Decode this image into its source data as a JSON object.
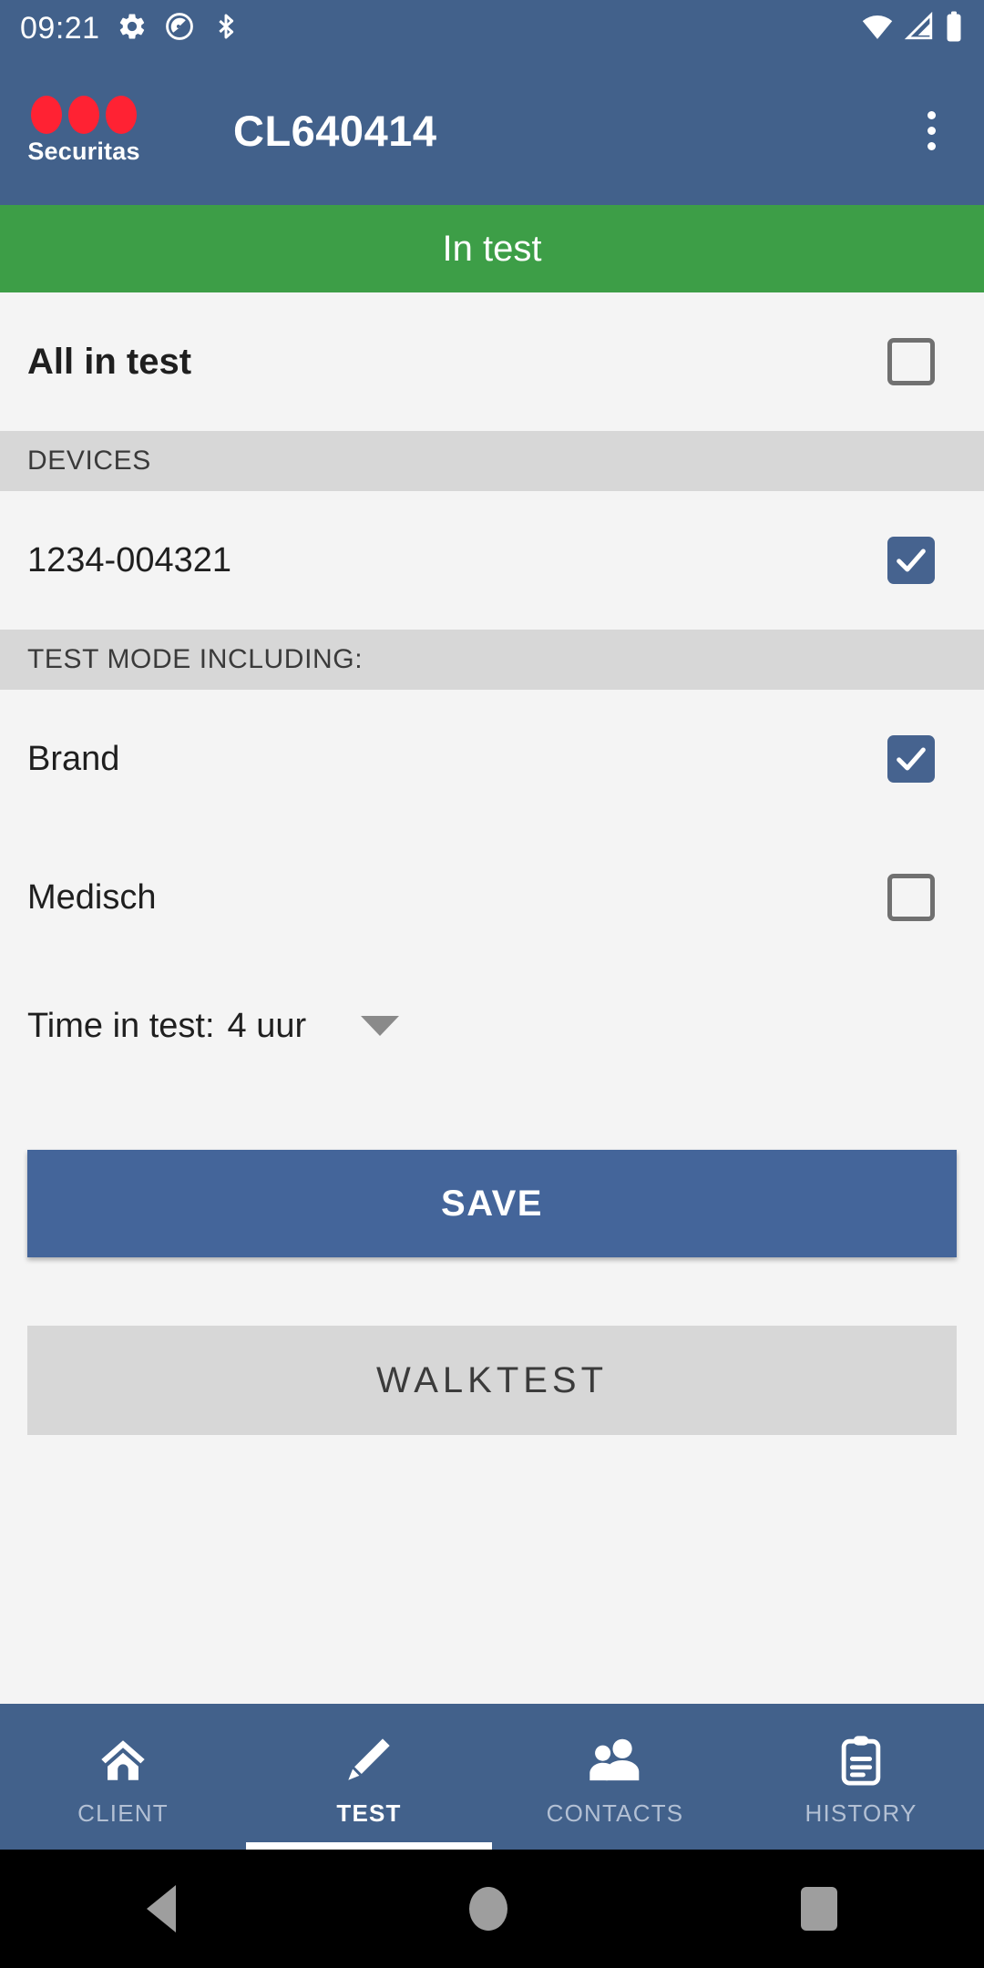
{
  "status_bar": {
    "time": "09:21",
    "left_icons": [
      "gear-icon",
      "quick-settings-icon",
      "bluetooth-icon"
    ],
    "right_icons": [
      "wifi-icon",
      "cellular-signal-icon",
      "battery-icon"
    ]
  },
  "app_bar": {
    "logo_name": "Securitas",
    "title": "CL640414",
    "overflow_label": "more-options"
  },
  "banner": {
    "text": "In test",
    "color": "#3D9E47"
  },
  "all_in_test": {
    "label": "All in test",
    "checked": false
  },
  "sections": [
    {
      "header": "DEVICES",
      "items": [
        {
          "label": "1234-004321",
          "checked": true
        }
      ]
    },
    {
      "header": "TEST MODE INCLUDING:",
      "items": [
        {
          "label": "Brand",
          "checked": true
        },
        {
          "label": "Medisch",
          "checked": false
        }
      ]
    }
  ],
  "time_in_test": {
    "label": "Time in test:",
    "value": "4 uur",
    "options": [
      "4 uur"
    ]
  },
  "buttons": {
    "save": "SAVE",
    "walktest": "WALKTEST"
  },
  "bottom_nav": {
    "items": [
      {
        "label": "CLIENT",
        "icon": "home-icon",
        "active": false
      },
      {
        "label": "TEST",
        "icon": "wand-icon",
        "active": true
      },
      {
        "label": "CONTACTS",
        "icon": "people-icon",
        "active": false
      },
      {
        "label": "HISTORY",
        "icon": "clipboard-icon",
        "active": false
      }
    ]
  },
  "system_nav": {
    "back": "back-button",
    "home": "home-button",
    "recent": "recent-apps-button"
  },
  "colors": {
    "primary": "#42618B",
    "accent_red": "#FF2233",
    "banner_green": "#3D9E47",
    "save_blue": "#44659A",
    "walktest_grey": "#D7D7D7"
  }
}
